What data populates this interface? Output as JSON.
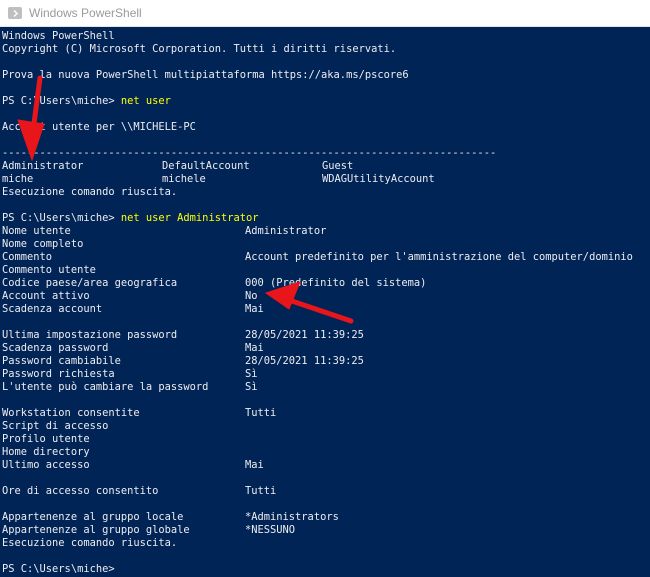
{
  "window": {
    "title": "Windows PowerShell",
    "icon": "powershell-icon"
  },
  "console": {
    "background": "#012456",
    "text_color": "#eeedf0",
    "command_color": "#ffff00",
    "lines": [
      {
        "text": "Windows PowerShell"
      },
      {
        "text": "Copyright (C) Microsoft Corporation. Tutti i diritti riservati."
      },
      {
        "text": ""
      },
      {
        "text": "Prova la nuova PowerShell multipiattaforma https://aka.ms/pscore6"
      },
      {
        "text": ""
      },
      {
        "prompt": "PS C:\\Users\\miche> ",
        "command": "net user"
      },
      {
        "text": ""
      },
      {
        "text": "Account utente per \\\\MICHELE-PC"
      },
      {
        "text": ""
      },
      {
        "text": "-------------------------------------------------------------------------------"
      },
      {
        "cols": [
          "Administrator",
          "DefaultAccount",
          "Guest"
        ]
      },
      {
        "cols": [
          "miche",
          "michele",
          "WDAGUtilityAccount"
        ]
      },
      {
        "text": "Esecuzione comando riuscita."
      },
      {
        "text": ""
      },
      {
        "prompt": "PS C:\\Users\\miche> ",
        "command": "net user Administrator"
      },
      {
        "label": "Nome utente",
        "value": "Administrator"
      },
      {
        "label": "Nome completo",
        "value": ""
      },
      {
        "label": "Commento",
        "value": "Account predefinito per l'amministrazione del computer/dominio"
      },
      {
        "label": "Commento utente",
        "value": ""
      },
      {
        "label": "Codice paese/area geografica",
        "value": "000 (Predefinito del sistema)"
      },
      {
        "label": "Account attivo",
        "value": "No"
      },
      {
        "label": "Scadenza account",
        "value": "Mai"
      },
      {
        "text": ""
      },
      {
        "label": "Ultima impostazione password",
        "value": "28/05/2021 11:39:25"
      },
      {
        "label": "Scadenza password",
        "value": "Mai"
      },
      {
        "label": "Password cambiabile",
        "value": "28/05/2021 11:39:25"
      },
      {
        "label": "Password richiesta",
        "value": "Sì"
      },
      {
        "label": "L'utente può cambiare la password",
        "value": "Sì"
      },
      {
        "text": ""
      },
      {
        "label": "Workstation consentite",
        "value": "Tutti"
      },
      {
        "label": "Script di accesso",
        "value": ""
      },
      {
        "label": "Profilo utente",
        "value": ""
      },
      {
        "label": "Home directory",
        "value": ""
      },
      {
        "label": "Ultimo accesso",
        "value": "Mai"
      },
      {
        "text": ""
      },
      {
        "label": "Ore di accesso consentito",
        "value": "Tutti"
      },
      {
        "text": ""
      },
      {
        "label": "Appartenenze al gruppo locale",
        "value": "*Administrators"
      },
      {
        "label": "Appartenenze al gruppo globale",
        "value": "*NESSUNO"
      },
      {
        "text": "Esecuzione comando riuscita."
      },
      {
        "text": ""
      },
      {
        "prompt": "PS C:\\Users\\miche> ",
        "command": ""
      }
    ]
  },
  "annotations": {
    "arrow_color": "#e8161b",
    "arrow_count": 2
  }
}
